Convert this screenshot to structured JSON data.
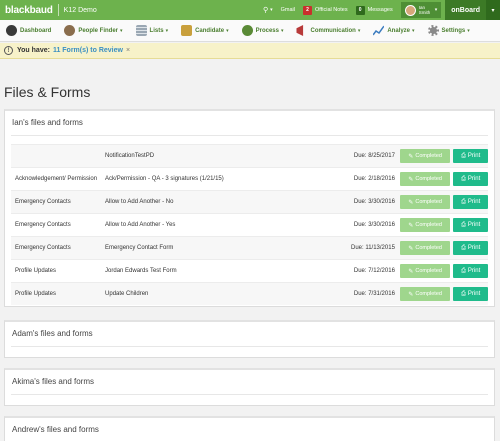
{
  "topbar": {
    "brand": "blackbaud",
    "site": "K12 Demo",
    "gmail_label": "Gmail",
    "notes_count": "2",
    "notes_label": "Official Notes",
    "messages_count": "0",
    "messages_label": "Messages",
    "user_name": "Ian Smith",
    "onboard_label": "onBoard"
  },
  "nav": {
    "items": [
      {
        "label": "Dashboard",
        "icon": "dashboard-icon",
        "has_caret": false,
        "color": "#3a3a3a"
      },
      {
        "label": "People Finder",
        "icon": "people-finder-icon",
        "has_caret": true,
        "color": "#8a6d4d"
      },
      {
        "label": "Lists",
        "icon": "lists-icon",
        "has_caret": true,
        "color": "#9aa7b3"
      },
      {
        "label": "Candidate",
        "icon": "candidate-icon",
        "has_caret": true,
        "color": "#c9a03c"
      },
      {
        "label": "Process",
        "icon": "process-icon",
        "has_caret": true,
        "color": "#5a8a36"
      },
      {
        "label": "Communication",
        "icon": "communication-icon",
        "has_caret": true,
        "color": "#b83a3a"
      },
      {
        "label": "Analyze",
        "icon": "analyze-icon",
        "has_caret": true,
        "color": "#3a7bbf"
      },
      {
        "label": "Settings",
        "icon": "settings-icon",
        "has_caret": true,
        "color": "#8a8a8a"
      }
    ]
  },
  "notice": {
    "text": "You have:",
    "link": "11 Form(s) to Review",
    "close": "×"
  },
  "page_title": "Files & Forms",
  "panels": [
    {
      "title": "Ian's files and forms",
      "rows": [
        {
          "category": "",
          "form": "NotificationTestPD",
          "due": "Due: 8/25/2017",
          "status": "Completed",
          "action": "Print"
        },
        {
          "category": "Acknowledgement/ Permission",
          "form": "Ack/Permission - QA - 3 signatures (1/21/15)",
          "due": "Due: 2/18/2016",
          "status": "Completed",
          "action": "Print"
        },
        {
          "category": "Emergency Contacts",
          "form": "Allow to Add Another - No",
          "due": "Due: 3/30/2016",
          "status": "Completed",
          "action": "Print"
        },
        {
          "category": "Emergency Contacts",
          "form": "Allow to Add Another - Yes",
          "due": "Due: 3/30/2016",
          "status": "Completed",
          "action": "Print"
        },
        {
          "category": "Emergency Contacts",
          "form": "Emergency Contact Form",
          "due": "Due: 11/13/2015",
          "status": "Completed",
          "action": "Print"
        },
        {
          "category": "Profile Updates",
          "form": "Jordan Edwards Test Form",
          "due": "Due: 7/12/2016",
          "status": "Completed",
          "action": "Print"
        },
        {
          "category": "Profile Updates",
          "form": "Update Children",
          "due": "Due: 7/31/2016",
          "status": "Completed",
          "action": "Print"
        }
      ]
    },
    {
      "title": "Adam's files and forms",
      "rows": []
    },
    {
      "title": "Akima's files and forms",
      "rows": []
    },
    {
      "title": "Andrew's files and forms",
      "rows": []
    }
  ]
}
